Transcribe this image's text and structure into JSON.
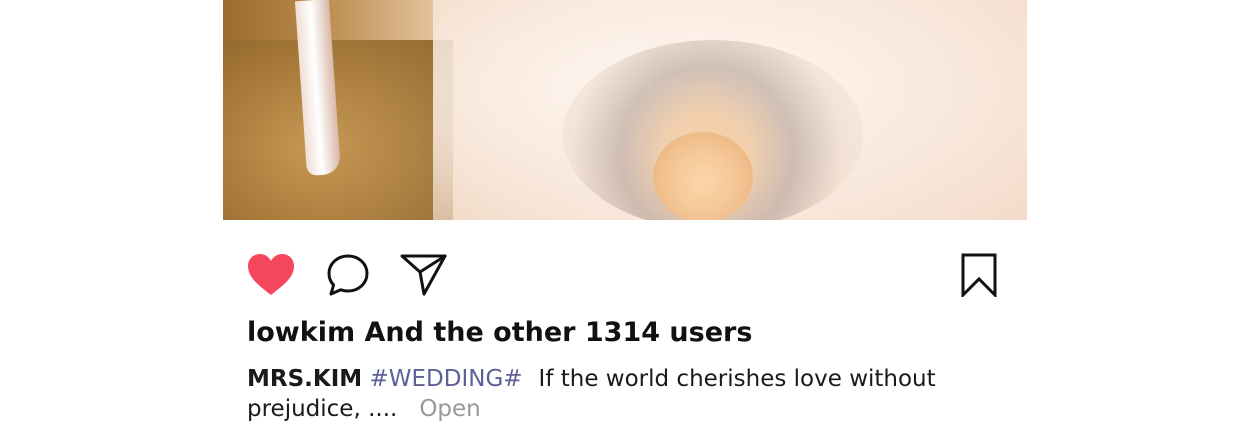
{
  "post": {
    "image_alt": "wedding photo",
    "likes_text": "lowkim And the other 1314 users",
    "caption": {
      "username": "MRS.KIM",
      "hashtag": "#WEDDING#",
      "text": "If the world cherishes love without prejudice, ....",
      "more_label": "Open"
    }
  },
  "actions": {
    "like_icon": "heart-filled-icon",
    "comment_icon": "speech-bubble-icon",
    "share_icon": "paper-plane-icon",
    "save_icon": "bookmark-icon",
    "like_color": "#f4475e",
    "icon_color": "#111111"
  },
  "colors": {
    "hashtag": "#5e5f99",
    "more": "#999999"
  }
}
